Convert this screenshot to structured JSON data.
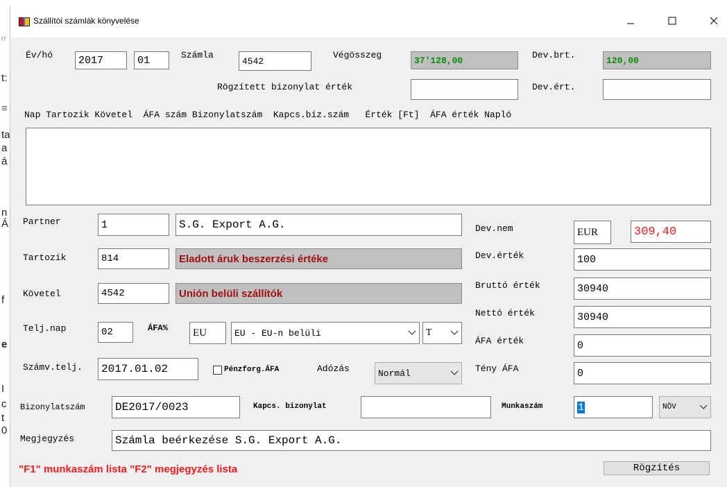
{
  "background_fragments": [
    "rr",
    "t:",
    "≡",
    "ta",
    "a",
    "á",
    "n",
    "Á",
    "f",
    "e",
    "I",
    "c",
    "t",
    "0"
  ],
  "window": {
    "title": "Szállítói számlák könyvelése",
    "icon": "app-book-icon",
    "controls": [
      "minimize-icon",
      "maximize-icon",
      "close-icon"
    ]
  },
  "header": {
    "ev_ho_label": "Év/hó",
    "ev_value": "2017",
    "ho_value": "01",
    "szamla_label": "Számla",
    "szamla_value": "4542",
    "vegosszeg_label": "Végösszeg",
    "vegosszeg_value": "37'128,00",
    "dev_brt_label": "Dev.brt.",
    "dev_brt_value": "120,00",
    "rogzitett_label": "Rögzített bizonylat érték",
    "rogzitett_value": "",
    "dev_ert_label": "Dev.ért.",
    "dev_ert_value": ""
  },
  "list": {
    "header": "Nap Tartozik Követel  ÁFA szám Bizonylatszám  Kapcs.biz.szám   Érték [Ft]  ÁFA érték Napló",
    "rows": []
  },
  "form": {
    "partner_label": "Partner",
    "partner_code": "1",
    "partner_name": "S.G. Export A.G.",
    "tartozik_label": "Tartozik",
    "tartozik_code": "814",
    "tartozik_name": "Eladott áruk beszerzési értéke",
    "kovetel_label": "Követel",
    "kovetel_code": "4542",
    "kovetel_name": "Unión belüli szállítók",
    "telj_nap_label": "Telj.nap",
    "telj_nap_value": "02",
    "afa_label": "ÁFA%",
    "afa_code": "EU",
    "afa_select": "EU - EU-n belüli",
    "afa_type": "T",
    "szamv_telj_label": "Számv.telj.",
    "szamv_telj_value": "2017.01.02",
    "penzforg_label": "Pénzforg.ÁFA",
    "penzforg_checked": false,
    "adozas_label": "Adózás",
    "adozas_value": "Normál",
    "bizonylatszam_label": "Bizonylatszám",
    "bizonylatszam_value": "DE2017/0023",
    "kapcs_label": "Kapcs. bizonylat",
    "kapcs_value": "",
    "munkaszam_label": "Munkaszám",
    "munkaszam_value": "1",
    "munkaszam_select": "NÖV",
    "megjegyzes_label": "Megjegyzés",
    "megjegyzes_value": "Számla beérkezése S.G. Export A.G."
  },
  "right_panel": {
    "dev_nem_label": "Dev.nem",
    "dev_nem_value": "EUR",
    "arfolyam_value": "309,40",
    "dev_ertek_label": "Dev.érték",
    "dev_ertek_value": "100",
    "brutto_label": "Bruttó érték",
    "brutto_value": "30940",
    "netto_label": "Nettó érték",
    "netto_value": "30940",
    "afa_ertek_label": "ÁFA érték",
    "afa_ertek_value": "0",
    "teny_afa_label": "Tény ÁFA",
    "teny_afa_value": "0"
  },
  "footer": {
    "hint": "\"F1\" munkaszám lista \"F2\" megjegyzés lista",
    "rogzites_label": "Rögzítés"
  },
  "colors": {
    "window_bg": "#f0f0f0",
    "grey_field": "#c0c0c0",
    "green_value": "#0a8a0a",
    "dark_red_value": "#a01010",
    "hint_red": "#ff1a1a",
    "selection_blue": "#0078d7"
  }
}
